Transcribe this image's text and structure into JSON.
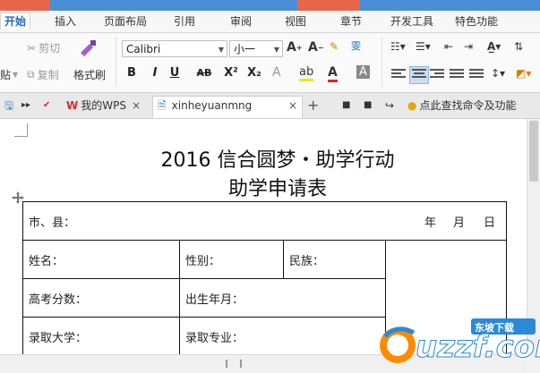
{
  "menu": {
    "tabs": [
      "开始",
      "插入",
      "页面布局",
      "引用",
      "审阅",
      "视图",
      "章节",
      "开发工具",
      "特色功能"
    ]
  },
  "ribbon": {
    "cut": "剪切",
    "copy": "复制",
    "format_painter": "格式刷",
    "paste_fragment": "贴",
    "font_name": "Calibri",
    "font_size": "小一",
    "bold": "B",
    "italic": "I",
    "underline": "U",
    "strikethrough": "AB",
    "superscript": "X²",
    "subscript": "X₂",
    "wen": "雯"
  },
  "tabbar": {
    "wps_tab": "我的WPS",
    "doc_tab": "xinheyuanmng",
    "add": "+",
    "search_tip": "点此查找命令及功能"
  },
  "document": {
    "title_line1": "2016 信合圆梦・助学行动",
    "title_line2": "助学申请表",
    "rows": {
      "city": "市、县：",
      "year": "年",
      "month": "月",
      "day": "日",
      "name": "姓名：",
      "gender": "性别：",
      "ethnicity": "民族：",
      "score": "高考分数：",
      "birth": "出生年月：",
      "university": "录取大学：",
      "major": "录取专业："
    }
  },
  "watermark": {
    "brand": "uzzf.com",
    "tag": "东坡下载"
  },
  "colors": {
    "accent": "#1f67c3",
    "title_blue": "#4a8fd6",
    "title_orange": "#e8664a"
  }
}
